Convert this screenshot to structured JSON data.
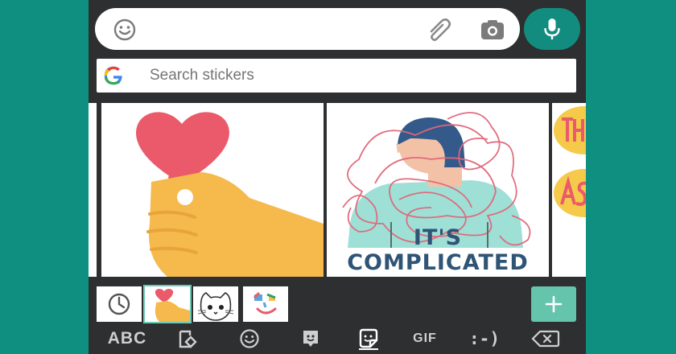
{
  "composer": {
    "emoji_icon": "emoji-icon",
    "attach_icon": "paperclip-icon",
    "camera_icon": "camera-icon",
    "mic_icon": "microphone-icon",
    "message_value": ""
  },
  "search": {
    "placeholder": "Search stickers",
    "logo": "google-g-icon"
  },
  "stickers": {
    "items": [
      {
        "name": "heart-in-hand-sticker",
        "caption": ""
      },
      {
        "name": "tangled-thoughts-sticker",
        "caption": "IT'S COMPLICATED"
      }
    ]
  },
  "tray": {
    "recent_icon": "clock-icon",
    "packs": [
      "heart-hand-pack",
      "cat-pack",
      "face-pack"
    ],
    "add_icon": "plus-icon"
  },
  "bottombar": {
    "abc_label": "ABC",
    "gif_label": "GIF",
    "emoticon_label": ":-)"
  },
  "colors": {
    "background": "#0f8f7f",
    "keyboard": "#2d2f31",
    "mic_button": "#128c7e",
    "add_button": "#64c4ac",
    "caption_text": "#2f5475"
  }
}
